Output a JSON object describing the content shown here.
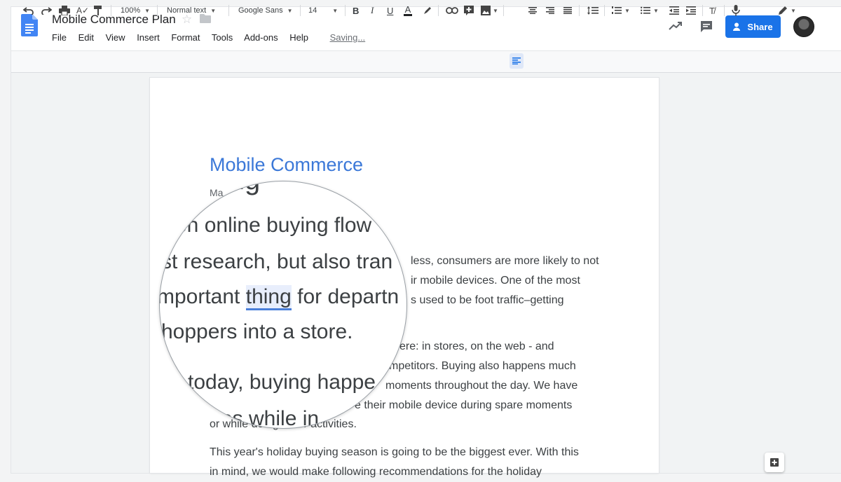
{
  "app": {
    "doc_title": "Mobile Commerce Plan",
    "menu": [
      "File",
      "Edit",
      "View",
      "Insert",
      "Format",
      "Tools",
      "Add-ons",
      "Help"
    ],
    "saving_status": "Saving...",
    "share_label": "Share"
  },
  "toolbar": {
    "zoom": "100%",
    "style": "Normal text",
    "font": "Google Sans",
    "size": "14",
    "bold": "B",
    "italic": "I",
    "underline": "U",
    "text_color": "A"
  },
  "document": {
    "heading": "Mobile Commerce",
    "subtitle": "Ma",
    "paragraphs_visible": [
      "less, consumers are more likely to not",
      "ir mobile devices. One of the most",
      "s used to be foot traffic–getting",
      "ere: in stores, on the web - and",
      "mpetitors. Buying also happens much",
      "moments throughout the day. We have",
      "e their mobile device during spare moments",
      "or while doing other activities."
    ],
    "paragraph_2_start": "This year's holiday buying season is going to be the biggest ever. With this",
    "paragraph_2_cut": "in mind, we would make following recommendations for the holiday"
  },
  "magnifier": {
    "line_top": "orning",
    "line1": "en online buying flow",
    "line2": "st research, but also tran",
    "line3_pre": "mportant ",
    "line3_word": "thing",
    "line3_post": " for departn",
    "line4": "hoppers into a store.",
    "line5": "today, buying happe",
    "line6": "ces while in"
  },
  "colors": {
    "accent_blue": "#1a73e8",
    "heading_blue": "#3b78d8",
    "docs_logo_blue": "#4285f4"
  },
  "icons": [
    "docs-logo-icon",
    "star-icon",
    "folder-icon",
    "trending-icon",
    "comment-icon",
    "people-icon",
    "undo-icon",
    "redo-icon",
    "print-icon",
    "spellcheck-icon",
    "paint-format-icon",
    "text-color-icon",
    "highlight-icon",
    "link-icon",
    "add-comment-icon",
    "image-icon",
    "align-left-icon",
    "align-center-icon",
    "align-right-icon",
    "justify-icon",
    "line-spacing-icon",
    "numbered-list-icon",
    "bulleted-list-icon",
    "decrease-indent-icon",
    "increase-indent-icon",
    "clear-formatting-icon",
    "voice-input-icon",
    "edit-mode-icon",
    "add-side-icon"
  ]
}
